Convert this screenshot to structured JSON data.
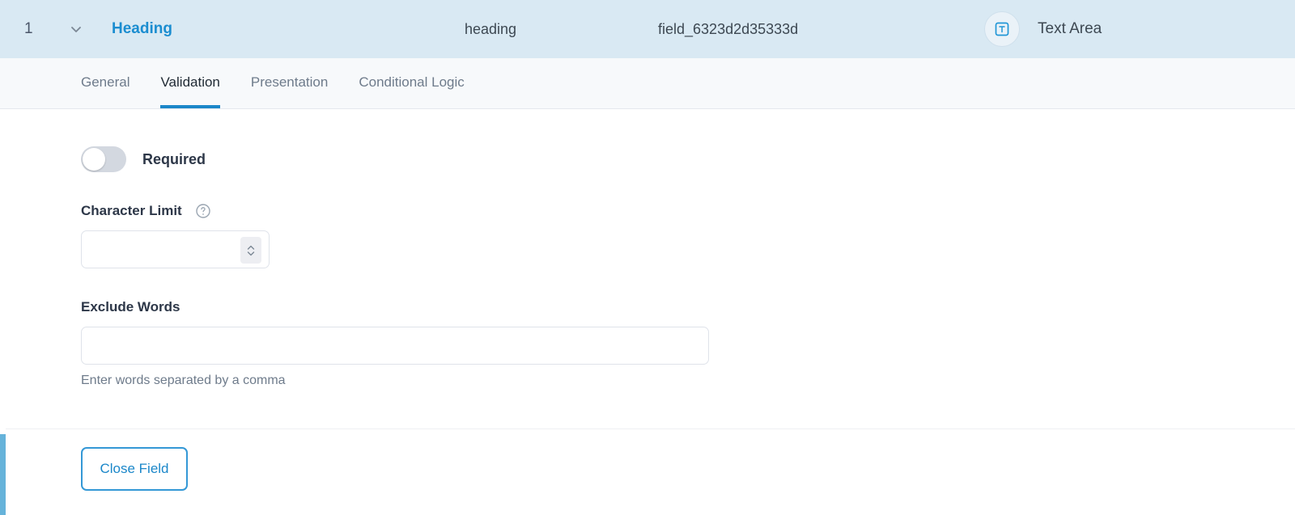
{
  "header": {
    "index": "1",
    "collapse_icon": "chevron-down-icon",
    "label": "Heading",
    "name": "heading",
    "id": "field_6323d2d35333d",
    "type_icon": "text-area-icon",
    "type_glyph": "T",
    "type_label": "Text Area",
    "background_color": "#d9e9f3",
    "label_color": "#1b8dd0"
  },
  "tabs": [
    {
      "label": "General",
      "active": false
    },
    {
      "label": "Validation",
      "active": true
    },
    {
      "label": "Presentation",
      "active": false
    },
    {
      "label": "Conditional Logic",
      "active": false
    }
  ],
  "tab_accent_color": "#1b87c9",
  "accent_bar_color": "#66b3da",
  "validation": {
    "required": {
      "label": "Required",
      "enabled": false
    },
    "character_limit": {
      "label": "Character Limit",
      "help_icon": "question-circle-icon",
      "value": "",
      "placeholder": ""
    },
    "exclude_words": {
      "label": "Exclude Words",
      "value": "",
      "placeholder": "",
      "help_text": "Enter words separated by a comma"
    }
  },
  "footer": {
    "close_label": "Close Field"
  }
}
